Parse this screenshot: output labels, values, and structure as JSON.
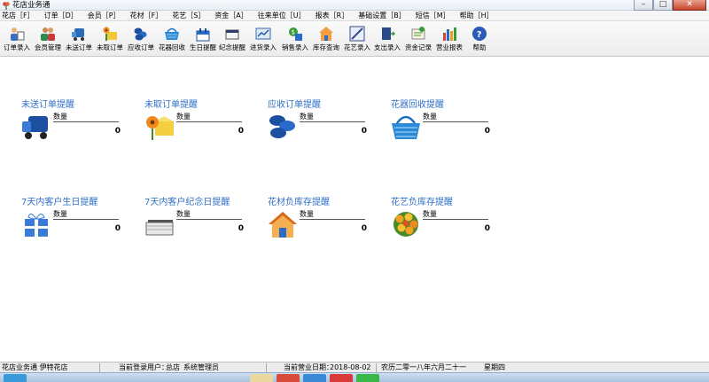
{
  "window": {
    "title": "花店业务通"
  },
  "menu": [
    "花店［F］",
    "订单［D］",
    "会员［P］",
    "花材［F］",
    "花艺［S］",
    "资金［A］",
    "往来单位［U］",
    "报表［R］",
    "基础设置［B］",
    "短信［M］",
    "帮助［H］"
  ],
  "toolbar": [
    {
      "label": "订单录入",
      "icon": "order-entry-icon"
    },
    {
      "label": "会员管理",
      "icon": "members-icon"
    },
    {
      "label": "未送订单",
      "icon": "undelivered-icon"
    },
    {
      "label": "未取订单",
      "icon": "unpicked-icon"
    },
    {
      "label": "应收订单",
      "icon": "receivable-icon"
    },
    {
      "label": "花器回收",
      "icon": "basket-icon"
    },
    {
      "label": "生日提醒",
      "icon": "birthday-icon"
    },
    {
      "label": "纪念提醒",
      "icon": "anniversary-icon"
    },
    {
      "label": "进货录入",
      "icon": "purchase-icon"
    },
    {
      "label": "销售录入",
      "icon": "sales-icon"
    },
    {
      "label": "库存查询",
      "icon": "inventory-icon"
    },
    {
      "label": "花艺录入",
      "icon": "floral-icon"
    },
    {
      "label": "支出录入",
      "icon": "expense-icon"
    },
    {
      "label": "资金记录",
      "icon": "funds-icon"
    },
    {
      "label": "营业报表",
      "icon": "report-icon"
    },
    {
      "label": "帮助",
      "icon": "help-icon"
    }
  ],
  "reminders": [
    {
      "title": "未送订单提醒",
      "qty_label": "数量",
      "value": "0",
      "icon": "delivery-truck-icon"
    },
    {
      "title": "未取订单提醒",
      "qty_label": "数量",
      "value": "0",
      "icon": "flower-box-icon"
    },
    {
      "title": "应收订单提醒",
      "qty_label": "数量",
      "value": "0",
      "icon": "coins-icon"
    },
    {
      "title": "花器回收提醒",
      "qty_label": "数量",
      "value": "0",
      "icon": "basket-icon"
    },
    {
      "title": "7天内客户生日提醒",
      "qty_label": "数量",
      "value": "0",
      "icon": "gift-icon"
    },
    {
      "title": "7天内客户纪念日提醒",
      "qty_label": "数量",
      "value": "0",
      "icon": "card-stack-icon"
    },
    {
      "title": "花材负库存提醒",
      "qty_label": "数量",
      "value": "0",
      "icon": "house-icon"
    },
    {
      "title": "花艺负库存提醒",
      "qty_label": "数量",
      "value": "0",
      "icon": "bouquet-icon"
    }
  ],
  "status": {
    "app": "花店业务通 伊特花店",
    "user_label": "当前登录用户：",
    "user_store": "总店",
    "user_name": "系统管理员",
    "date_label": "当前营业日期：",
    "date": "2018-08-02",
    "lunar": "农历二零一八年六月二十一",
    "weekday": "星期四"
  }
}
